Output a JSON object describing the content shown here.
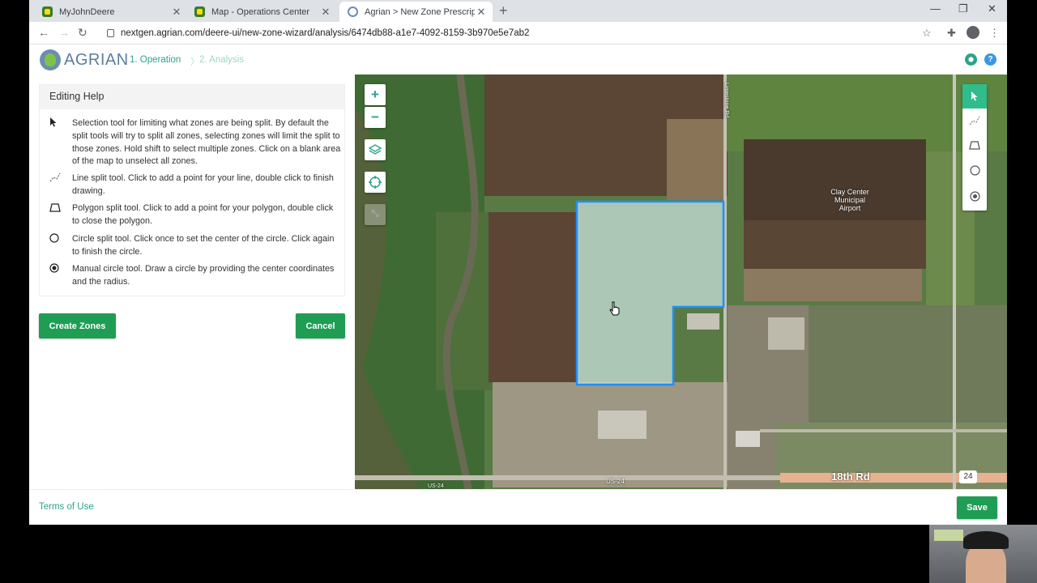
{
  "browser": {
    "tabs": [
      {
        "title": "MyJohnDeere",
        "active": false
      },
      {
        "title": "Map - Operations Center",
        "active": false
      },
      {
        "title": "Agrian > New Zone Prescription",
        "active": true
      }
    ],
    "url": "nextgen.agrian.com/deere-ui/new-zone-wizard/analysis/6474db88-a1e7-4092-8159-3b970e5e7ab2"
  },
  "header": {
    "logo_text": "AGRIAN",
    "steps": [
      "1. Operation",
      "2. Analysis"
    ],
    "help_glyph": "?"
  },
  "editing_help": {
    "title": "Editing Help",
    "items": [
      {
        "icon": "cursor-arrow-icon",
        "text": "Selection tool for limiting what zones are being split. By default the split tools will try to split all zones, selecting zones will limit the split to those zones. Hold shift to select multiple zones. Click on a blank area of the map to unselect all zones."
      },
      {
        "icon": "line-split-icon",
        "text": "Line split tool. Click to add a point for your line, double click to finish drawing."
      },
      {
        "icon": "polygon-split-icon",
        "text": "Polygon split tool. Click to add a point for your polygon, double click to close the polygon."
      },
      {
        "icon": "circle-split-icon",
        "text": "Circle split tool. Click once to set the center of the circle. Click again to finish the circle."
      },
      {
        "icon": "manual-circle-icon",
        "text": "Manual circle tool. Draw a circle by providing the center coordinates and the radius."
      }
    ]
  },
  "buttons": {
    "create_zones": "Create Zones",
    "cancel": "Cancel",
    "save": "Save"
  },
  "map": {
    "zoom_in": "+",
    "zoom_out": "−",
    "labels": {
      "airport": "Clay Center Municipal Airport",
      "road_18th": "18th Rd",
      "highway": "US-24",
      "highway_left": "US-24",
      "shield": "24",
      "limestone": "Limestone Rd"
    }
  },
  "footer": {
    "terms": "Terms of Use"
  },
  "colors": {
    "accent": "#2ba38a",
    "button": "#1f9d55",
    "selection": "#1e90ff"
  }
}
